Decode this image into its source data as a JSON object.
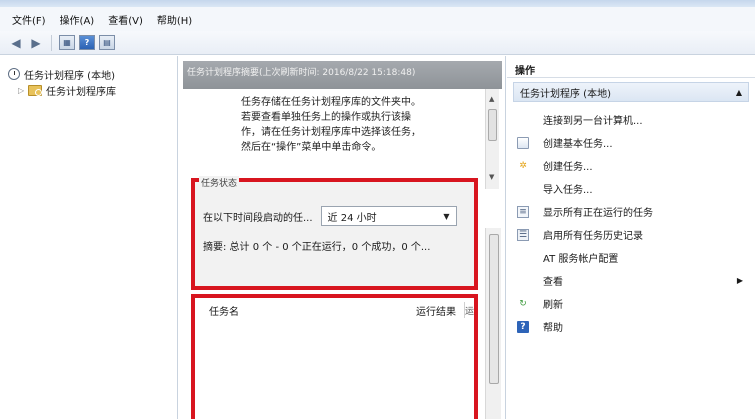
{
  "menu": [
    "文件(F)",
    "操作(A)",
    "查看(V)",
    "帮助(H)"
  ],
  "tree": {
    "root_label": "任务计划程序 (本地)",
    "child_label": "任务计划程序库"
  },
  "center": {
    "header": "任务计划程序摘要(上次刷新时间: 2016/8/22 15:18:48)",
    "summary_lines": [
      "任务存储在任务计划程序库的文件夹中。",
      "若要查看单独任务上的操作或执行该操",
      "作，请在任务计划程序库中选择该任务，",
      "然后在“操作”菜单中单击命令。"
    ],
    "status_title": "任务状态",
    "filter_label": "在以下时间段启动的任...",
    "filter_value": "近 24 小时",
    "status_summary": "摘要: 总计 0 个 - 0 个正在运行，0 个成功，0 个...",
    "columns": [
      "任务名",
      "运行结果",
      "运"
    ]
  },
  "actions": {
    "title": "操作",
    "group_label": "任务计划程序 (本地)",
    "items": [
      {
        "label": "连接到另一台计算机...",
        "icon": "none"
      },
      {
        "label": "创建基本任务...",
        "icon": "calendar-icon"
      },
      {
        "label": "创建任务...",
        "icon": "wand-icon"
      },
      {
        "label": "导入任务...",
        "icon": "none"
      },
      {
        "label": "显示所有正在运行的任务",
        "icon": "list-icon"
      },
      {
        "label": "启用所有任务历史记录",
        "icon": "history-icon"
      },
      {
        "label": "AT 服务帐户配置",
        "icon": "none"
      },
      {
        "label": "查看",
        "icon": "none",
        "submenu": true
      },
      {
        "label": "刷新",
        "icon": "refresh-icon"
      },
      {
        "label": "帮助",
        "icon": "help-icon"
      }
    ]
  },
  "colors": {
    "highlight_border": "#d8151f",
    "header_bg": "#9a9ea3"
  }
}
